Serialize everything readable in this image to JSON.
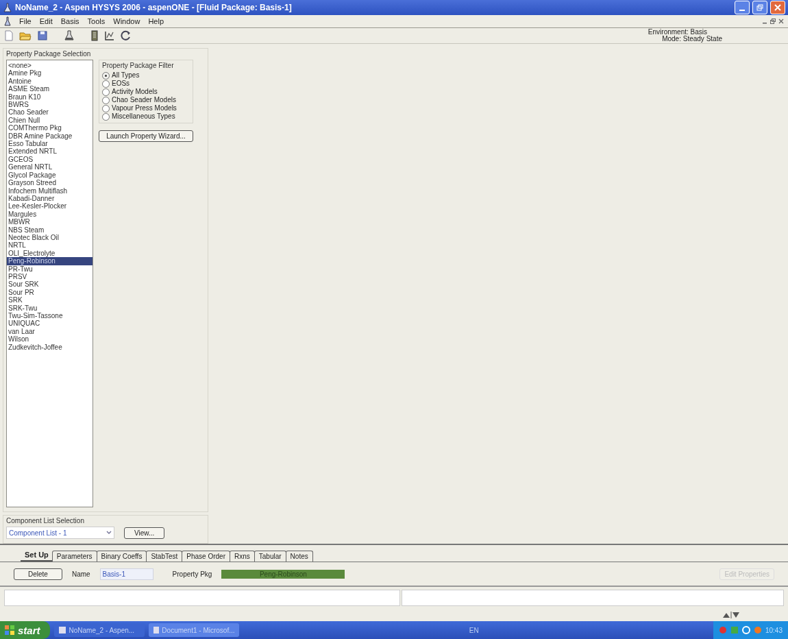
{
  "window": {
    "title": "NoName_2 - Aspen HYSYS 2006 - aspenONE - [Fluid Package: Basis-1]"
  },
  "menu": [
    "File",
    "Edit",
    "Basis",
    "Tools",
    "Window",
    "Help"
  ],
  "environment": {
    "environment": "Environment: Basis",
    "mode": "Mode: Steady State"
  },
  "property_package_selection": {
    "title": "Property Package Selection",
    "items": [
      {
        "label": "<none>",
        "selected": false
      },
      {
        "label": "Amine Pkg",
        "selected": false
      },
      {
        "label": "Antoine",
        "selected": false
      },
      {
        "label": "ASME Steam",
        "selected": false
      },
      {
        "label": "Braun K10",
        "selected": false
      },
      {
        "label": "BWRS",
        "selected": false
      },
      {
        "label": "Chao Seader",
        "selected": false
      },
      {
        "label": "Chien Null",
        "selected": false
      },
      {
        "label": "COMThermo Pkg",
        "selected": false
      },
      {
        "label": "DBR Amine Package",
        "selected": false
      },
      {
        "label": "Esso Tabular",
        "selected": false
      },
      {
        "label": "Extended NRTL",
        "selected": false
      },
      {
        "label": "GCEOS",
        "selected": false
      },
      {
        "label": "General NRTL",
        "selected": false
      },
      {
        "label": "Glycol Package",
        "selected": false
      },
      {
        "label": "Grayson Streed",
        "selected": false
      },
      {
        "label": "Infochem Multiflash",
        "selected": false
      },
      {
        "label": "Kabadi-Danner",
        "selected": false
      },
      {
        "label": "Lee-Kesler-Plocker",
        "selected": false
      },
      {
        "label": "Margules",
        "selected": false
      },
      {
        "label": "MBWR",
        "selected": false
      },
      {
        "label": "NBS Steam",
        "selected": false
      },
      {
        "label": "Neotec Black Oil",
        "selected": false
      },
      {
        "label": "NRTL",
        "selected": false
      },
      {
        "label": "OLI_Electrolyte",
        "selected": false
      },
      {
        "label": "Peng-Robinson",
        "selected": true
      },
      {
        "label": "PR-Twu",
        "selected": false
      },
      {
        "label": "PRSV",
        "selected": false
      },
      {
        "label": "Sour SRK",
        "selected": false
      },
      {
        "label": "Sour PR",
        "selected": false
      },
      {
        "label": "SRK",
        "selected": false
      },
      {
        "label": "SRK-Twu",
        "selected": false
      },
      {
        "label": "Twu-Sim-Tassone",
        "selected": false
      },
      {
        "label": "UNIQUAC",
        "selected": false
      },
      {
        "label": "van Laar",
        "selected": false
      },
      {
        "label": "Wilson",
        "selected": false
      },
      {
        "label": "Zudkevitch-Joffee",
        "selected": false
      }
    ]
  },
  "property_package_filter": {
    "title": "Property Package Filter",
    "options": [
      {
        "label": "All Types",
        "selected": true
      },
      {
        "label": "EOSs",
        "selected": false
      },
      {
        "label": "Activity Models",
        "selected": false
      },
      {
        "label": "Chao Seader Models",
        "selected": false
      },
      {
        "label": "Vapour Press Models",
        "selected": false
      },
      {
        "label": "Miscellaneous Types",
        "selected": false
      }
    ]
  },
  "launch_button": "Launch Property Wizard...",
  "component_list_selection": {
    "title": "Component List Selection",
    "value": "Component List - 1",
    "button": "View..."
  },
  "tabs": [
    {
      "label": "Set Up",
      "selected": true
    },
    {
      "label": "Parameters",
      "selected": false
    },
    {
      "label": "Binary Coeffs",
      "selected": false
    },
    {
      "label": "StabTest",
      "selected": false
    },
    {
      "label": "Phase Order",
      "selected": false
    },
    {
      "label": "Rxns",
      "selected": false
    },
    {
      "label": "Tabular",
      "selected": false
    },
    {
      "label": "Notes",
      "selected": false
    }
  ],
  "setup": {
    "delete_button": "Delete",
    "name_label": "Name",
    "name_value": "Basis-1",
    "property_pkg_label": "Property Pkg",
    "property_pkg_value": "Peng-Robinson",
    "edit_button": {
      "label": "Edit Properties",
      "disabled": true
    }
  },
  "taskbar": {
    "start": "start",
    "tasks": [
      {
        "label": "NoName_2 - Aspen...",
        "selected": false
      },
      {
        "label": "Document1 - Microsof...",
        "selected": true
      }
    ],
    "language": "EN",
    "clock": "10:43"
  }
}
